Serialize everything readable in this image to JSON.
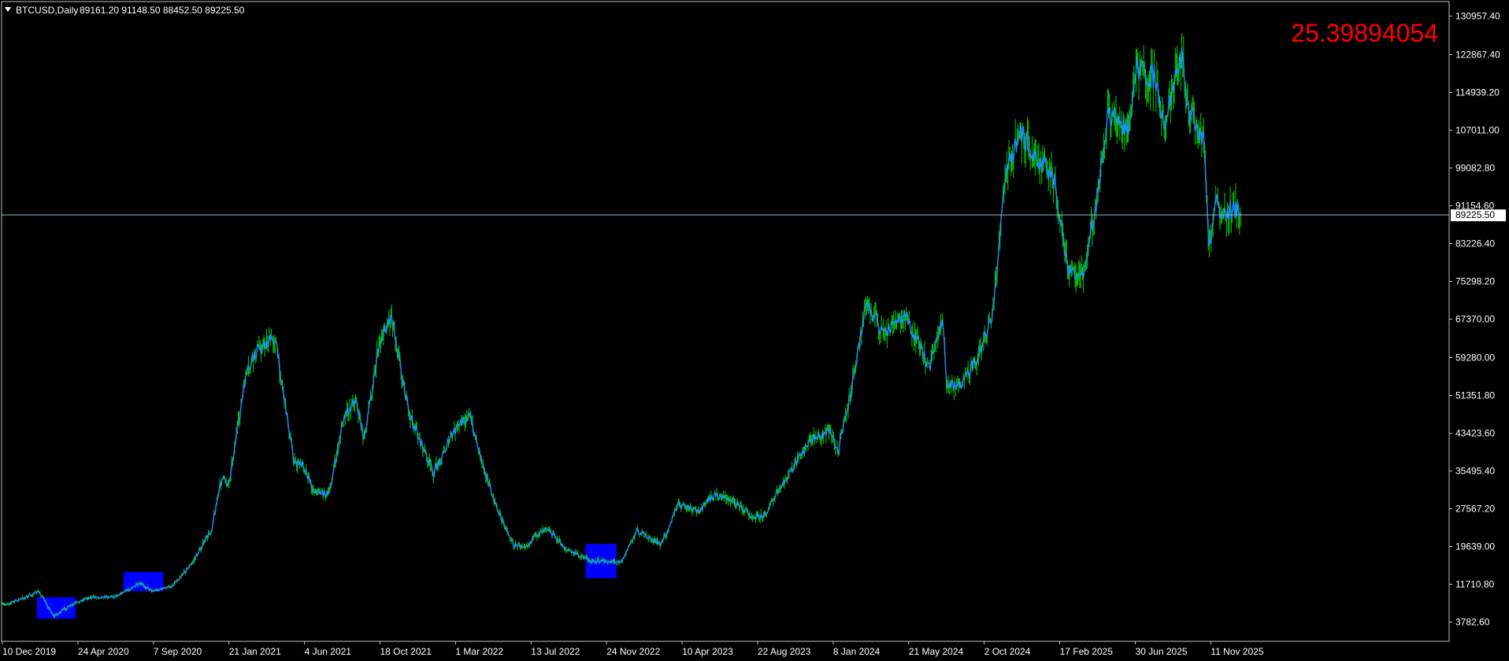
{
  "header": {
    "symbol_label": "BTCUSD,Daily",
    "ohlc": "89161.20 91148.50 88452.50 89225.50"
  },
  "indicator": {
    "value": "25.39894054",
    "color": "#ff0000"
  },
  "colors": {
    "background": "#000000",
    "frame": "#c0c0c0",
    "candle_line": "#00d000",
    "price_line": "#1e90ff",
    "highlight_box": "#0000ff",
    "current_price_line": "#8fb3c8"
  },
  "chart_data": {
    "type": "line",
    "title": "",
    "xlabel": "",
    "ylabel": "",
    "grid": false,
    "ylim": [
      -250,
      134000
    ],
    "x_ticks": [
      "10 Dec 2019",
      "24 Apr 2020",
      "7 Sep 2020",
      "21 Jan 2021",
      "4 Jun 2021",
      "18 Oct 2021",
      "1 Mar 2022",
      "13 Jul 2022",
      "24 Nov 2022",
      "10 Apr 2023",
      "22 Aug 2023",
      "8 Jan 2024",
      "21 May 2024",
      "2 Oct 2024",
      "17 Feb 2025",
      "30 Jun 2025",
      "11 Nov 2025"
    ],
    "y_ticks": [
      "130957.40",
      "122867.40",
      "114939.20",
      "107011.00",
      "99082.80",
      "91154.60",
      "83226.40",
      "75298.20",
      "67370.00",
      "59280.00",
      "51351.80",
      "43423.60",
      "35495.40",
      "27567.20",
      "19639.00",
      "11710.80",
      "3782.60"
    ],
    "y_tick_values": [
      130957.4,
      122867.4,
      114939.2,
      107011.0,
      99082.8,
      91154.6,
      83226.4,
      75298.2,
      67370.0,
      59280.0,
      51351.8,
      43423.6,
      35495.4,
      27567.2,
      19639.0,
      11710.8,
      3782.6
    ],
    "current_price": "89225.50",
    "current_price_value": 89225.5,
    "series": [
      {
        "x": [
          "2019-12-10",
          "2020-01-15",
          "2020-02-14",
          "2020-03-12",
          "2020-03-31",
          "2020-05-10",
          "2020-06-30",
          "2020-08-15",
          "2020-09-07",
          "2020-10-10",
          "2020-11-15",
          "2020-12-20",
          "2021-01-08",
          "2021-01-21",
          "2021-02-20",
          "2021-03-13",
          "2021-04-14",
          "2021-05-19",
          "2021-06-04",
          "2021-06-22",
          "2021-07-20",
          "2021-08-15",
          "2021-09-06",
          "2021-09-21",
          "2021-10-18",
          "2021-11-10",
          "2021-12-10",
          "2022-01-24",
          "2022-03-01",
          "2022-03-29",
          "2022-05-12",
          "2022-06-18",
          "2022-07-13",
          "2022-08-14",
          "2022-09-20",
          "2022-11-09",
          "2022-11-24",
          "2022-12-30",
          "2023-01-25",
          "2023-03-10",
          "2023-04-10",
          "2023-05-15",
          "2023-06-15",
          "2023-07-15",
          "2023-08-22",
          "2023-09-11",
          "2023-10-25",
          "2023-12-05",
          "2024-01-08",
          "2024-01-23",
          "2024-02-15",
          "2024-03-14",
          "2024-04-15",
          "2024-05-21",
          "2024-07-05",
          "2024-07-29",
          "2024-08-05",
          "2024-09-06",
          "2024-10-02",
          "2024-10-28",
          "2024-11-13",
          "2024-11-22",
          "2024-12-17",
          "2025-01-20",
          "2025-02-17",
          "2025-03-11",
          "2025-04-07",
          "2025-05-05",
          "2025-05-22",
          "2025-06-30",
          "2025-07-14",
          "2025-08-14",
          "2025-09-01",
          "2025-10-06",
          "2025-10-10",
          "2025-11-11",
          "2025-11-21",
          "2025-12-03",
          "2025-12-14",
          "2026-01-03",
          "2026-01-18"
        ],
        "y": [
          7300,
          8700,
          10200,
          5000,
          6500,
          8900,
          9200,
          11800,
          10300,
          11300,
          16000,
          23000,
          34000,
          33000,
          55000,
          61000,
          63500,
          37000,
          37000,
          31500,
          30500,
          46000,
          51000,
          42000,
          62000,
          68500,
          48000,
          35000,
          43500,
          47500,
          29500,
          19800,
          20000,
          24000,
          19000,
          16500,
          16500,
          16600,
          23000,
          20000,
          28500,
          27000,
          30500,
          29500,
          26000,
          26000,
          34500,
          42000,
          44000,
          40000,
          52000,
          71000,
          64000,
          68500,
          57000,
          68000,
          53500,
          54000,
          60000,
          69000,
          90000,
          99000,
          106000,
          101000,
          96000,
          78000,
          76000,
          94500,
          110000,
          107500,
          120000,
          118000,
          108000,
          123500,
          112000,
          105000,
          82000,
          92000,
          88000,
          91000,
          89225
        ]
      }
    ],
    "highlight_zones": [
      {
        "x_start": "2020-02-10",
        "x_end": "2020-04-20",
        "y_low": 4500,
        "y_high": 9000
      },
      {
        "x_start": "2020-07-15",
        "x_end": "2020-09-25",
        "y_low": 10300,
        "y_high": 14300
      },
      {
        "x_start": "2022-10-25",
        "x_end": "2022-12-20",
        "y_low": 13000,
        "y_high": 20200
      }
    ]
  }
}
